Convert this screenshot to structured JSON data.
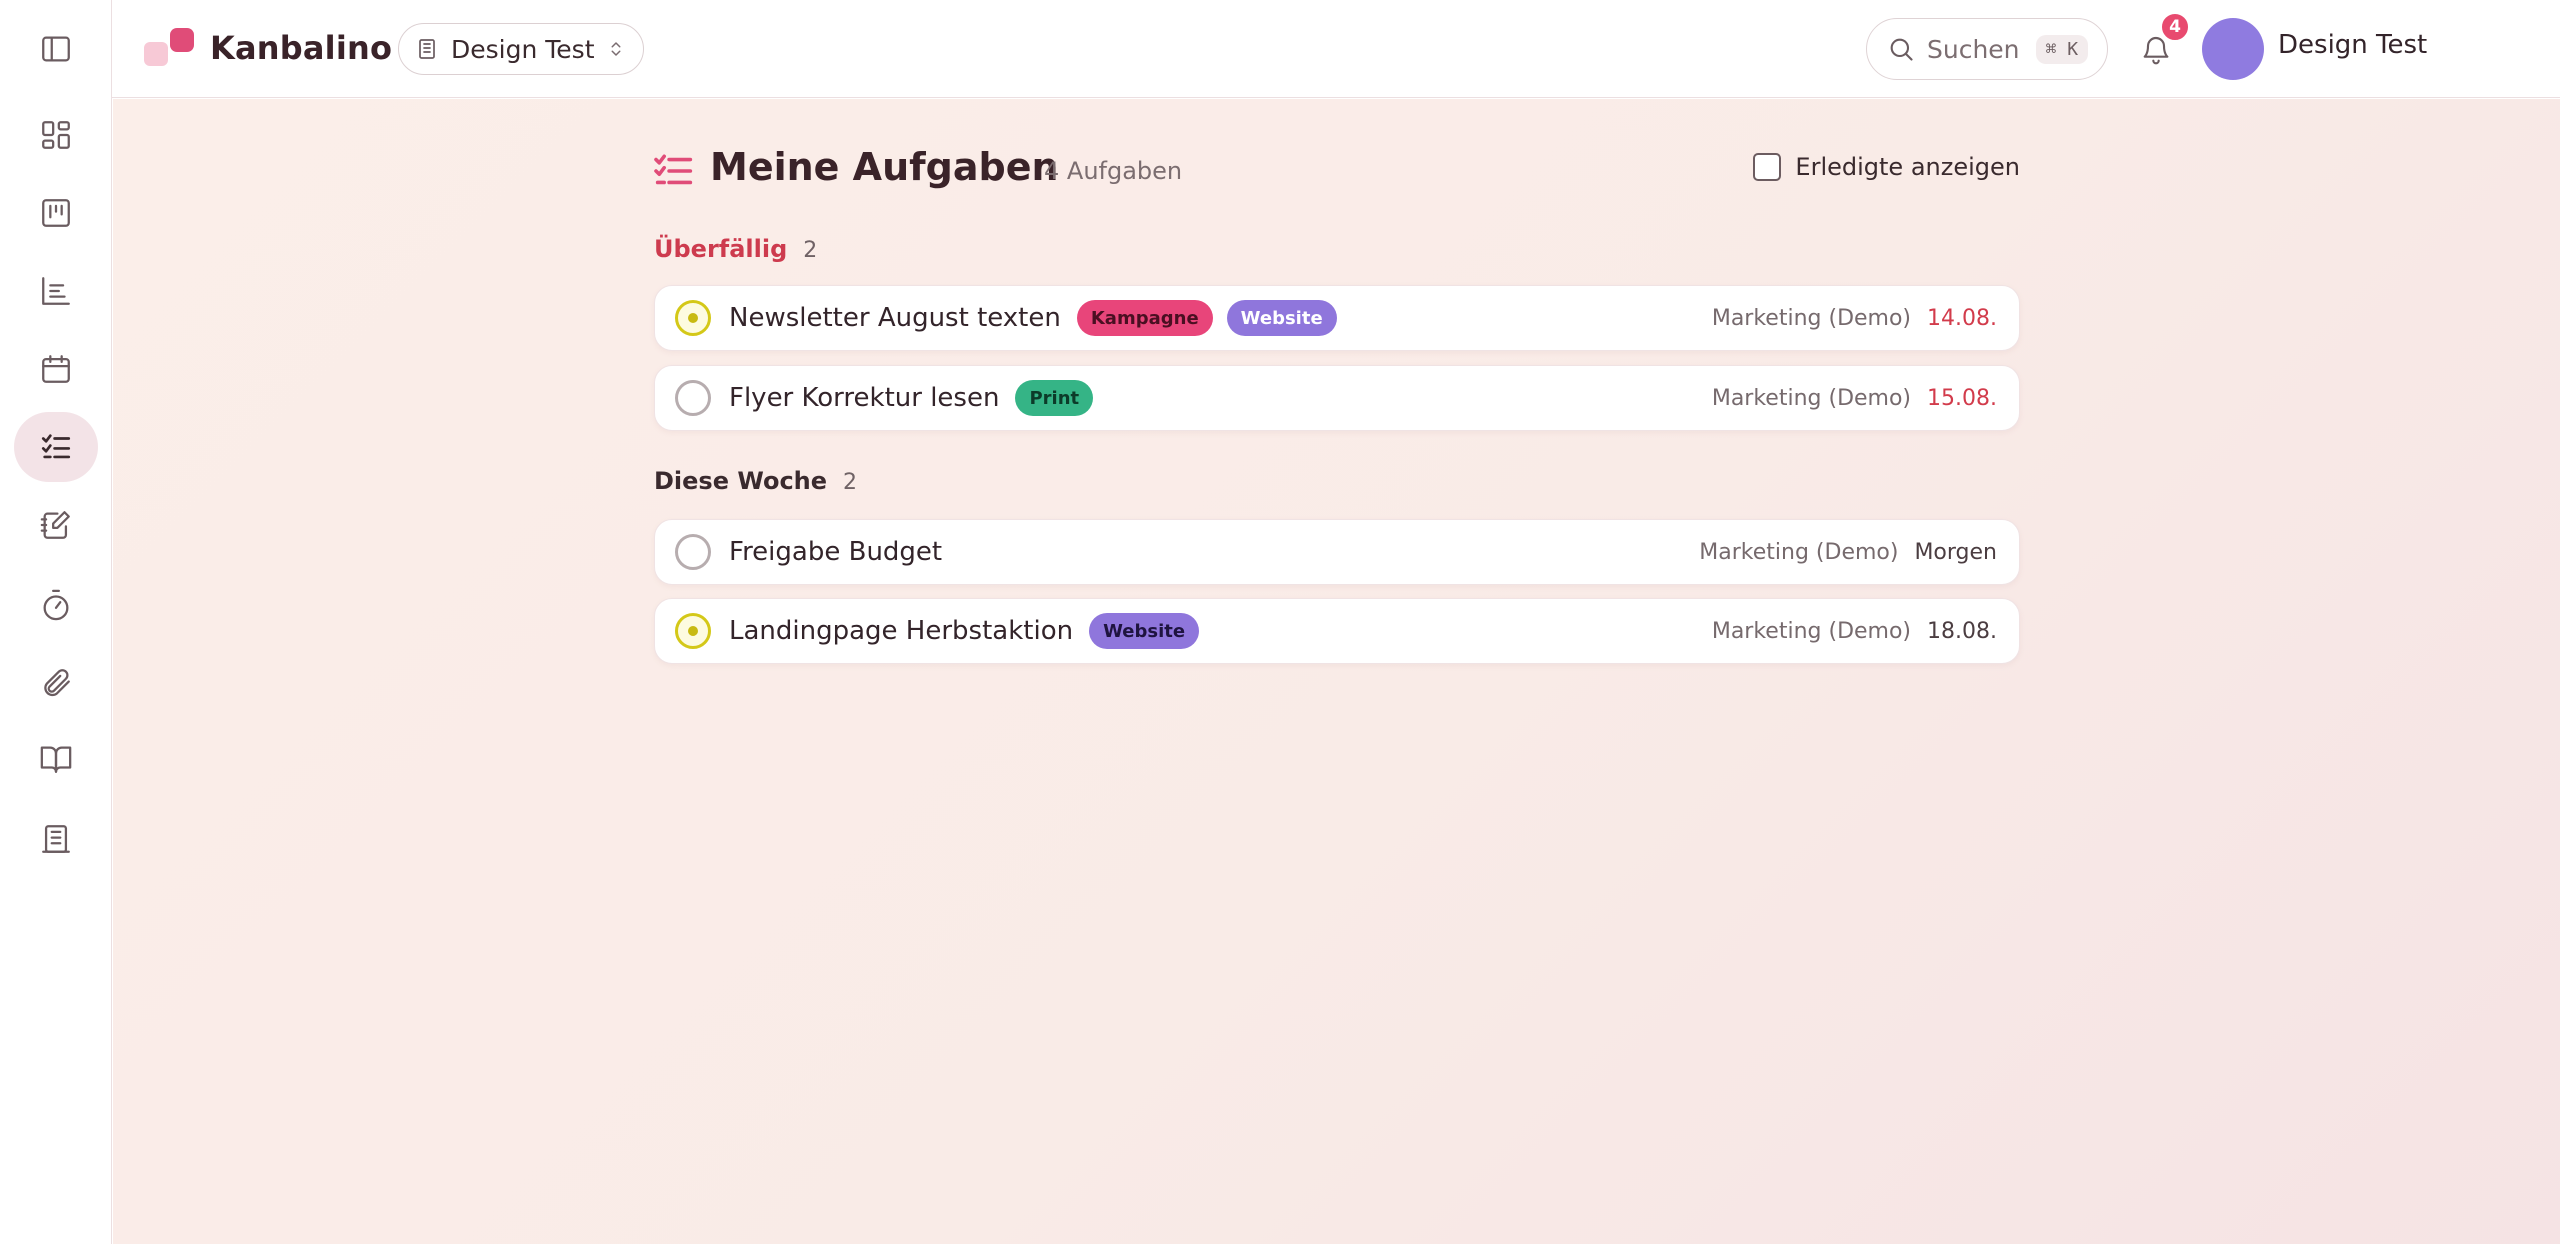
{
  "app": {
    "name": "Kanbalino"
  },
  "workspace": {
    "name": "Design Test"
  },
  "search": {
    "label": "Suchen",
    "shortcut": "⌘ K"
  },
  "notifications": {
    "count": "4"
  },
  "user": {
    "name": "Design Test"
  },
  "sidebar": {
    "items": [
      {
        "icon": "sidebar-toggle-icon"
      },
      {
        "icon": "dashboard-icon"
      },
      {
        "icon": "kanban-board-icon"
      },
      {
        "icon": "list-chart-icon"
      },
      {
        "icon": "calendar-icon"
      },
      {
        "icon": "task-list-icon",
        "active": true
      },
      {
        "icon": "notes-icon"
      },
      {
        "icon": "timer-icon"
      },
      {
        "icon": "paperclip-icon"
      },
      {
        "icon": "book-icon"
      },
      {
        "icon": "building-icon"
      }
    ]
  },
  "page": {
    "title": "Meine Aufgaben",
    "task_count": "4 Aufgaben",
    "show_done_label": "Erledigte anzeigen"
  },
  "groups": [
    {
      "label": "Überfällig",
      "count": "2",
      "tasks": [
        {
          "title": "Newsletter August texten",
          "tags": [
            {
              "label": "Kampagne",
              "bg": "#e8457a",
              "fg": "#4a0f22"
            },
            {
              "label": "Website",
              "bg": "#8f76dc",
              "fg": "#ffffff"
            }
          ],
          "project": "Marketing (Demo)",
          "due": "14.08.",
          "due_state": "overdue",
          "priority": true
        },
        {
          "title": "Flyer Korrektur lesen",
          "tags": [
            {
              "label": "Print",
              "bg": "#35b486",
              "fg": "#0c3b29"
            }
          ],
          "project": "Marketing (Demo)",
          "due": "15.08.",
          "due_state": "overdue",
          "priority": false
        }
      ]
    },
    {
      "label": "Diese Woche",
      "count": "2",
      "tasks": [
        {
          "title": "Freigabe Budget",
          "tags": [],
          "project": "Marketing (Demo)",
          "due": "Morgen",
          "due_state": "normal",
          "priority": false
        },
        {
          "title": "Landingpage Herbstaktion",
          "tags": [
            {
              "label": "Website",
              "bg": "#8f76dc",
              "fg": "#1f1440"
            }
          ],
          "project": "Marketing (Demo)",
          "due": "18.08.",
          "due_state": "normal",
          "priority": true
        }
      ]
    }
  ],
  "colors": {
    "accent": "#e04c78",
    "overdue": "#cd3b4e",
    "priority": "#d4c818"
  }
}
